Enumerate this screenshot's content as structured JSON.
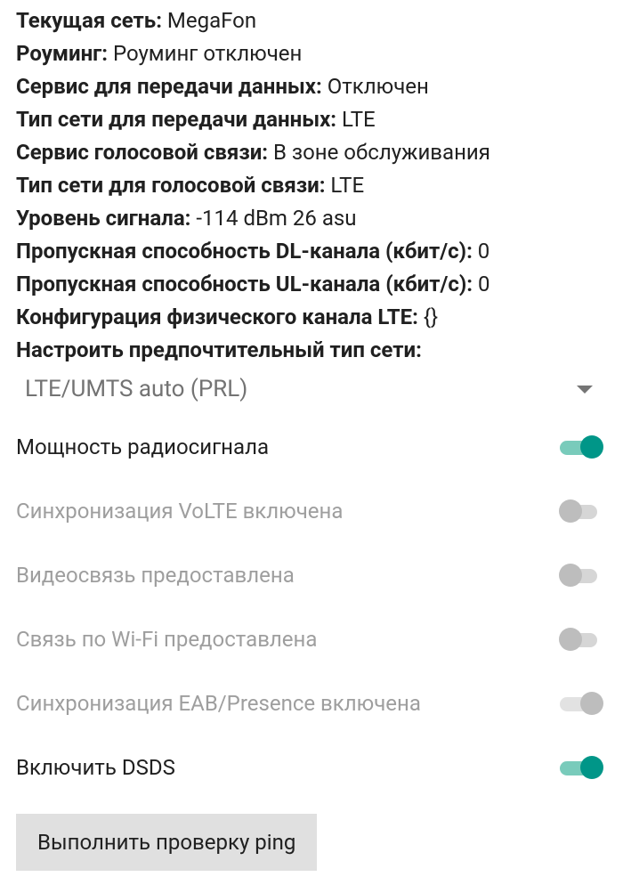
{
  "info": {
    "current_network_label": "Текущая сеть:",
    "current_network_value": "MegaFon",
    "roaming_label": "Роуминг:",
    "roaming_value": "Роуминг отключен",
    "data_service_label": "Сервис для передачи данных:",
    "data_service_value": "Отключен",
    "data_network_type_label": "Тип сети для передачи данных:",
    "data_network_type_value": "LTE",
    "voice_service_label": "Сервис голосовой связи:",
    "voice_service_value": "В зоне обслуживания",
    "voice_network_type_label": "Тип сети для голосовой связи:",
    "voice_network_type_value": "LTE",
    "signal_strength_label": "Уровень сигнала:",
    "signal_strength_value": "-114 dBm   26 asu",
    "dl_bandwidth_label": "Пропускная способность DL-канала (кбит/с):",
    "dl_bandwidth_value": "0",
    "ul_bandwidth_label": "Пропускная способность UL-канала (кбит/с):",
    "ul_bandwidth_value": "0",
    "lte_config_label": "Конфигурация физического канала LTE:",
    "lte_config_value": "{}",
    "preferred_network_label": "Настроить предпочтительный тип сети:"
  },
  "dropdown": {
    "selected": "LTE/UMTS auto (PRL)"
  },
  "toggles": {
    "radio_power": "Мощность радиосигнала",
    "volte": "Синхронизация VoLTE включена",
    "video": "Видеосвязь предоставлена",
    "wifi": "Связь по Wi-Fi предоставлена",
    "eab": "Синхронизация EAB/Presence включена",
    "dsds": "Включить DSDS"
  },
  "button": {
    "ping": "Выполнить проверку ping"
  }
}
